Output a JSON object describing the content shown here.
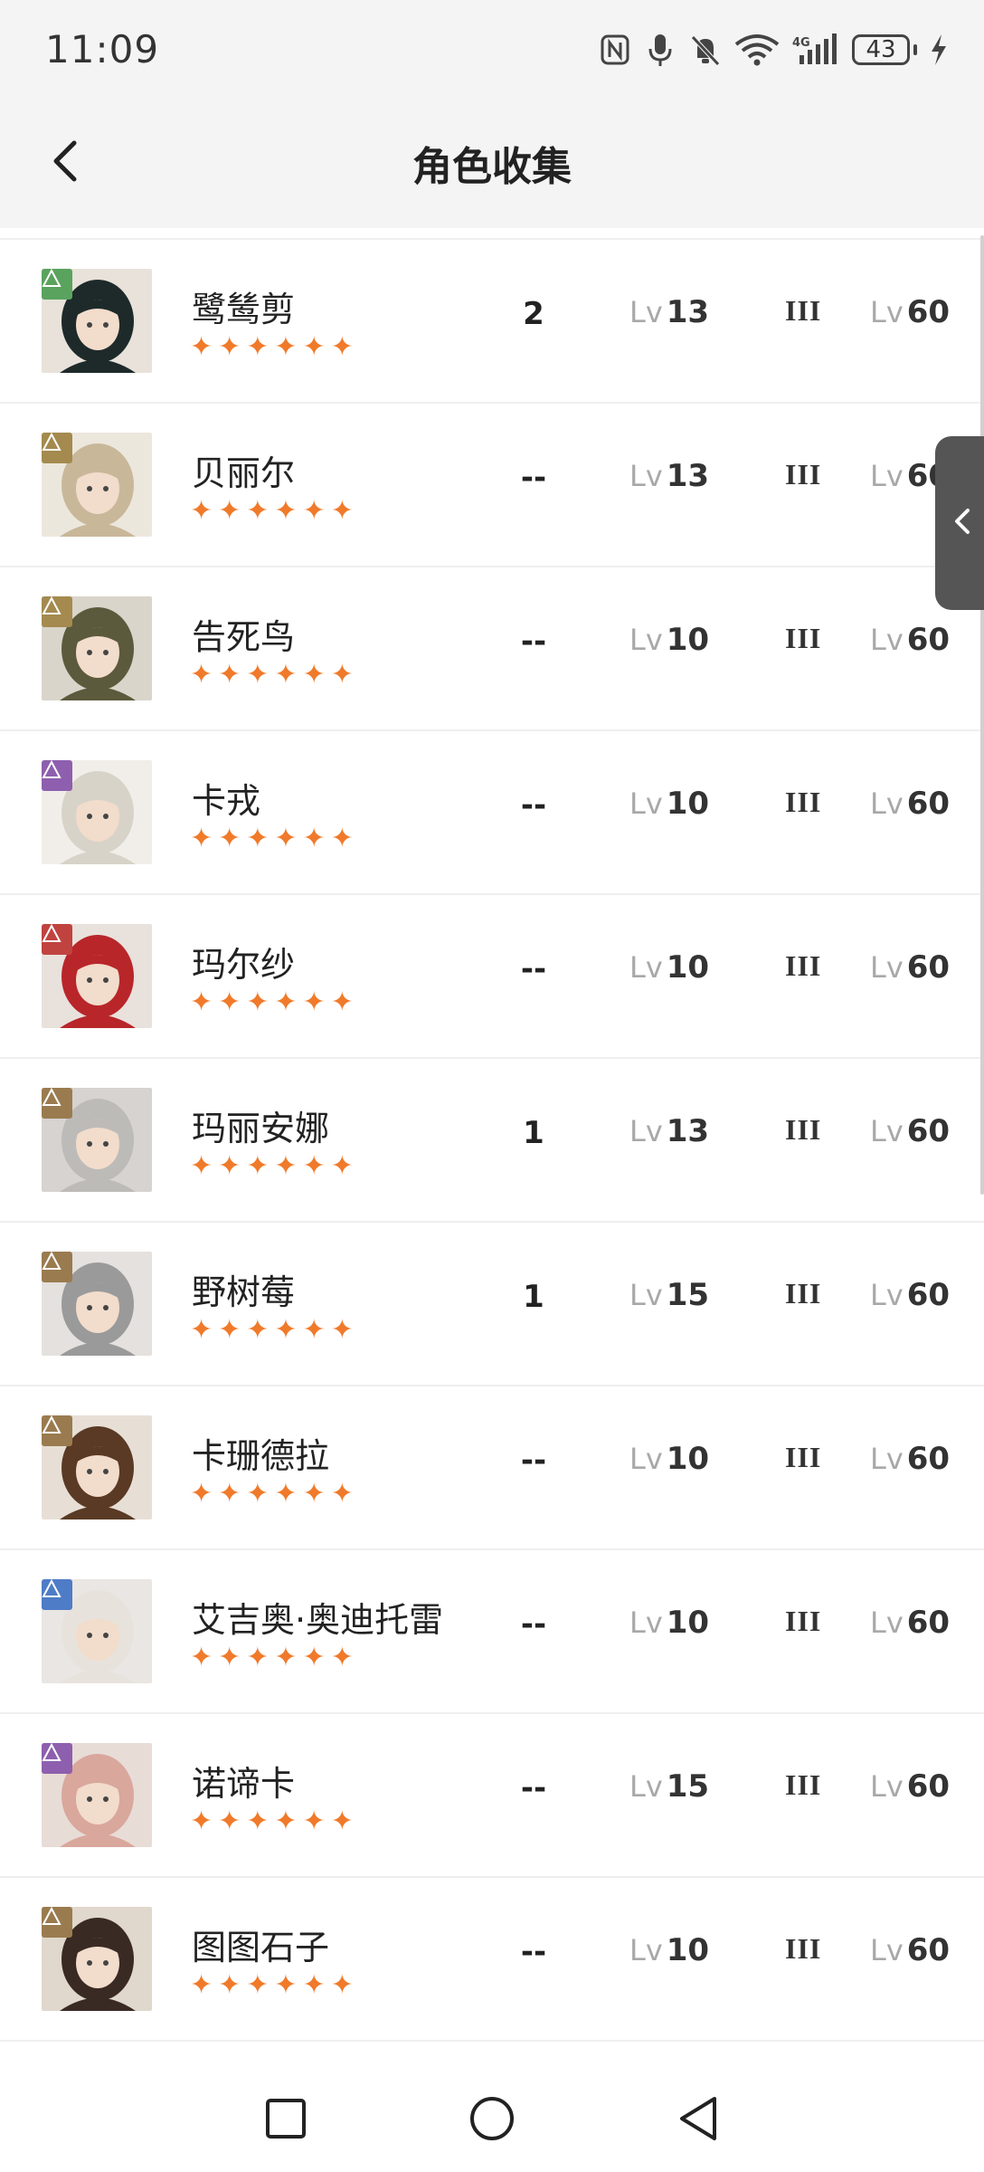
{
  "status_bar": {
    "time": "11:09",
    "battery": "43",
    "icons": [
      "nfc-icon",
      "mic-icon",
      "mute-icon",
      "wifi-icon",
      "signal-4g-icon",
      "battery-icon",
      "charging-icon"
    ]
  },
  "header": {
    "title": "角色收集",
    "back_icon": "back-arrow-icon"
  },
  "colors": {
    "star": "#f07a2a",
    "plant": "#5aa35e",
    "star_aff": "#a48a4e",
    "spirit": "#8e5fae",
    "beast": "#c0433f",
    "mineral": "#9a7b4f",
    "astral": "#4f7cc6"
  },
  "characters": [
    {
      "name": "鹭鸶剪",
      "copies": "2",
      "lv_prefix": "Lv",
      "skill_level": "13",
      "insight": "III",
      "max_level": "60",
      "element": "plant",
      "stars": 6
    },
    {
      "name": "贝丽尔",
      "copies": "--",
      "lv_prefix": "Lv",
      "skill_level": "13",
      "insight": "III",
      "max_level": "60",
      "element": "star_aff",
      "stars": 6
    },
    {
      "name": "告死鸟",
      "copies": "--",
      "lv_prefix": "Lv",
      "skill_level": "10",
      "insight": "III",
      "max_level": "60",
      "element": "star_aff",
      "stars": 6
    },
    {
      "name": "卡戎",
      "copies": "--",
      "lv_prefix": "Lv",
      "skill_level": "10",
      "insight": "III",
      "max_level": "60",
      "element": "spirit",
      "stars": 6
    },
    {
      "name": "玛尔纱",
      "copies": "--",
      "lv_prefix": "Lv",
      "skill_level": "10",
      "insight": "III",
      "max_level": "60",
      "element": "beast",
      "stars": 6
    },
    {
      "name": "玛丽安娜",
      "copies": "1",
      "lv_prefix": "Lv",
      "skill_level": "13",
      "insight": "III",
      "max_level": "60",
      "element": "mineral",
      "stars": 6
    },
    {
      "name": "野树莓",
      "copies": "1",
      "lv_prefix": "Lv",
      "skill_level": "15",
      "insight": "III",
      "max_level": "60",
      "element": "mineral",
      "stars": 6
    },
    {
      "name": "卡珊德拉",
      "copies": "--",
      "lv_prefix": "Lv",
      "skill_level": "10",
      "insight": "III",
      "max_level": "60",
      "element": "mineral",
      "stars": 6
    },
    {
      "name": "艾吉奥·奥迪托雷",
      "copies": "--",
      "lv_prefix": "Lv",
      "skill_level": "10",
      "insight": "III",
      "max_level": "60",
      "element": "astral",
      "stars": 6
    },
    {
      "name": "诺谛卡",
      "copies": "--",
      "lv_prefix": "Lv",
      "skill_level": "15",
      "insight": "III",
      "max_level": "60",
      "element": "spirit",
      "stars": 6
    },
    {
      "name": "图图石子",
      "copies": "--",
      "lv_prefix": "Lv",
      "skill_level": "10",
      "insight": "III",
      "max_level": "60",
      "element": "mineral",
      "stars": 6
    }
  ],
  "side_tab_icon": "chevron-left-icon",
  "nav_bar": {
    "buttons": [
      "recents-square-icon",
      "home-circle-icon",
      "back-triangle-icon"
    ]
  }
}
